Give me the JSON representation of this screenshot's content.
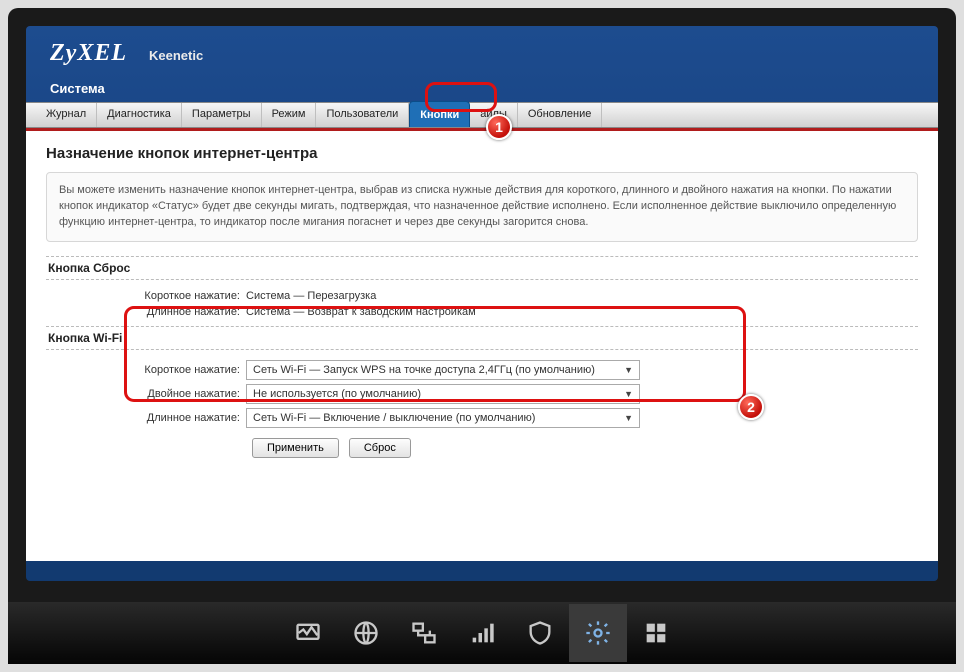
{
  "header": {
    "logo": "ZyXEL",
    "model": "Keenetic",
    "section": "Система"
  },
  "tabs": [
    {
      "label": "Журнал"
    },
    {
      "label": "Диагностика"
    },
    {
      "label": "Параметры"
    },
    {
      "label": "Режим"
    },
    {
      "label": "Пользователи"
    },
    {
      "label": "Кнопки",
      "active": true
    },
    {
      "label": "айлы"
    },
    {
      "label": "Обновление"
    }
  ],
  "page": {
    "title": "Назначение кнопок интернет-центра",
    "info": "Вы можете изменить назначение кнопок интернет-центра, выбрав из списка нужные действия для короткого, длинного и двойного нажатия на кнопки. По нажатии кнопок индикатор «Статус» будет две секунды мигать, подтверждая, что назначенное действие исполнено. Если исполненное действие выключило определенную функцию интернет-центра, то индикатор после мигания погаснет и через две секунды загорится снова."
  },
  "reset_group": {
    "title": "Кнопка Сброс",
    "rows": [
      {
        "label": "Короткое нажатие:",
        "value": "Система — Перезагрузка"
      },
      {
        "label": "Длинное нажатие:",
        "value": "Система — Возврат к заводским настройкам"
      }
    ]
  },
  "wifi_group": {
    "title": "Кнопка Wi-Fi",
    "rows": [
      {
        "label": "Короткое нажатие:",
        "value": "Сеть Wi-Fi — Запуск WPS на точке доступа 2,4ГГц (по умолчанию)"
      },
      {
        "label": "Двойное нажатие:",
        "value": "Не используется (по умолчанию)"
      },
      {
        "label": "Длинное нажатие:",
        "value": "Сеть Wi-Fi — Включение / выключение (по умолчанию)"
      }
    ]
  },
  "buttons": {
    "apply": "Применить",
    "reset": "Сброс"
  },
  "callouts": {
    "one": "1",
    "two": "2"
  }
}
